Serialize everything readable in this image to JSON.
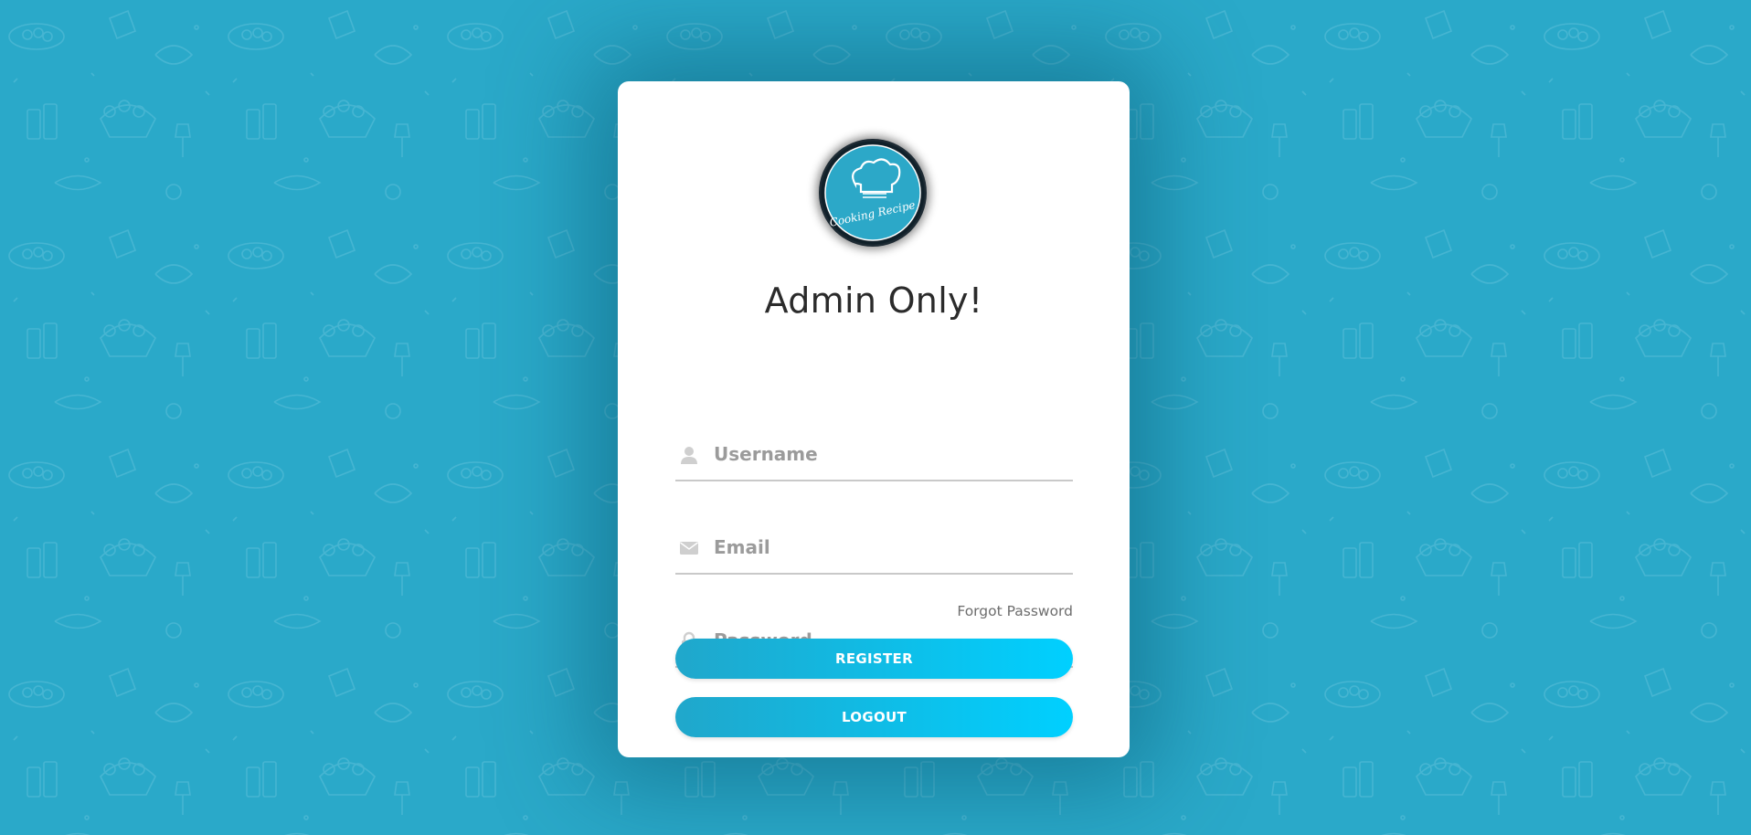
{
  "logo": {
    "alt_text": "Cooking Recipe",
    "icon": "chef-hat-icon"
  },
  "heading": "Admin Only!",
  "form": {
    "username": {
      "placeholder": "Username",
      "value": "",
      "icon": "user-icon"
    },
    "email": {
      "placeholder": "Email",
      "value": "",
      "icon": "envelope-icon"
    },
    "password": {
      "placeholder": "Password",
      "value": "",
      "icon": "lock-icon"
    },
    "forgot_password": "Forgot Password"
  },
  "buttons": {
    "register": "REGISTER",
    "logout": "LOGOUT"
  },
  "colors": {
    "background": "#2aa9c9",
    "button_gradient_start": "#20a7cb",
    "button_gradient_end": "#00d0ff",
    "card": "#ffffff",
    "heading": "#2b2b2b"
  }
}
